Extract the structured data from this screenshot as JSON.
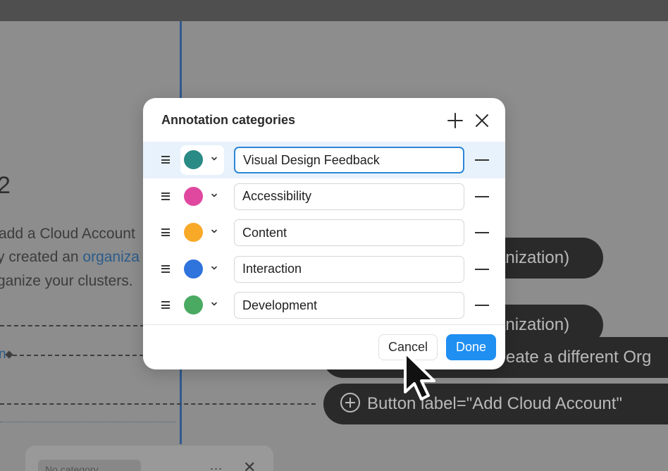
{
  "background": {
    "heading": "2",
    "line1": "add a Cloud Account",
    "line2_prefix": "y created an ",
    "line2_link": "organiza",
    "line3": "ganize your clusters.",
    "link_stub": "n",
    "pills": [
      {
        "text": "anization)"
      },
      {
        "text": "anization)"
      },
      {
        "text": "eate a different Org"
      },
      {
        "text": "Button label=\"Add Cloud Account\""
      }
    ],
    "bottom_chip": "No category",
    "bottom_dots": "...",
    "bottom_close": "✕"
  },
  "modal": {
    "title": "Annotation categories",
    "categories": [
      {
        "name": "Visual Design Feedback",
        "color": "#2a8a86",
        "selected": true
      },
      {
        "name": "Accessibility",
        "color": "#e0489f",
        "selected": false
      },
      {
        "name": "Content",
        "color": "#f8a928",
        "selected": false
      },
      {
        "name": "Interaction",
        "color": "#2f73dc",
        "selected": false
      },
      {
        "name": "Development",
        "color": "#4aaa62",
        "selected": false
      }
    ],
    "cancel_label": "Cancel",
    "done_label": "Done"
  },
  "colors": {
    "accent": "#1f8ff2",
    "selected_row_bg": "#e8f2fc"
  },
  "icons": {
    "add": "plus-icon",
    "close": "close-icon",
    "drag": "drag-handle-icon",
    "chevron": "chevron-down-icon",
    "remove": "minus-icon",
    "cursor": "arrow-cursor-icon"
  }
}
